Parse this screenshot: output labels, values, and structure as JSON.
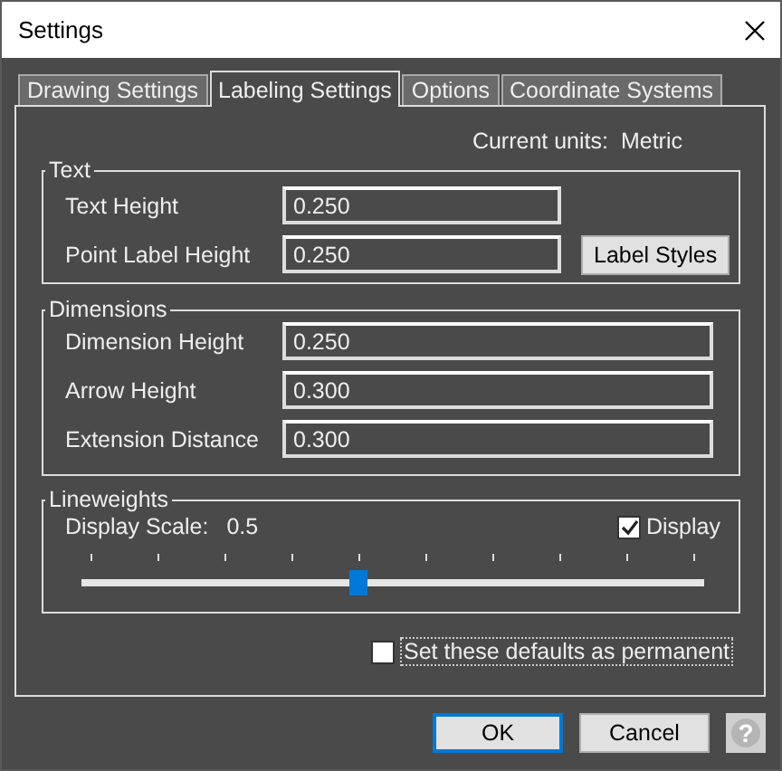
{
  "window": {
    "title": "Settings"
  },
  "tabs": [
    {
      "label": "Drawing Settings",
      "selected": false
    },
    {
      "label": "Labeling Settings",
      "selected": true
    },
    {
      "label": "Options",
      "selected": false
    },
    {
      "label": "Coordinate Systems",
      "selected": false
    }
  ],
  "current_units": {
    "label": "Current units:",
    "value": "Metric"
  },
  "text_group": {
    "title": "Text",
    "fields": [
      {
        "label": "Text Height",
        "value": "0.250"
      },
      {
        "label": "Point Label Height",
        "value": "0.250"
      }
    ],
    "button": "Label Styles"
  },
  "dimensions_group": {
    "title": "Dimensions",
    "fields": [
      {
        "label": "Dimension Height",
        "value": "0.250"
      },
      {
        "label": "Arrow Height",
        "value": "0.300"
      },
      {
        "label": "Extension Distance",
        "value": "0.300"
      }
    ]
  },
  "lineweights_group": {
    "title": "Lineweights",
    "scale_label": "Display Scale:",
    "scale_value": "0.5",
    "display": {
      "label": "Display",
      "checked": true
    },
    "slider": {
      "level": 0.444
    }
  },
  "permanent": {
    "label": "Set these defaults as permanent",
    "checked": false
  },
  "buttons": [
    {
      "label": "OK",
      "kind": "default"
    },
    {
      "label": "Cancel",
      "kind": "normal"
    }
  ],
  "help": {
    "label": "?",
    "disabled": true
  }
}
